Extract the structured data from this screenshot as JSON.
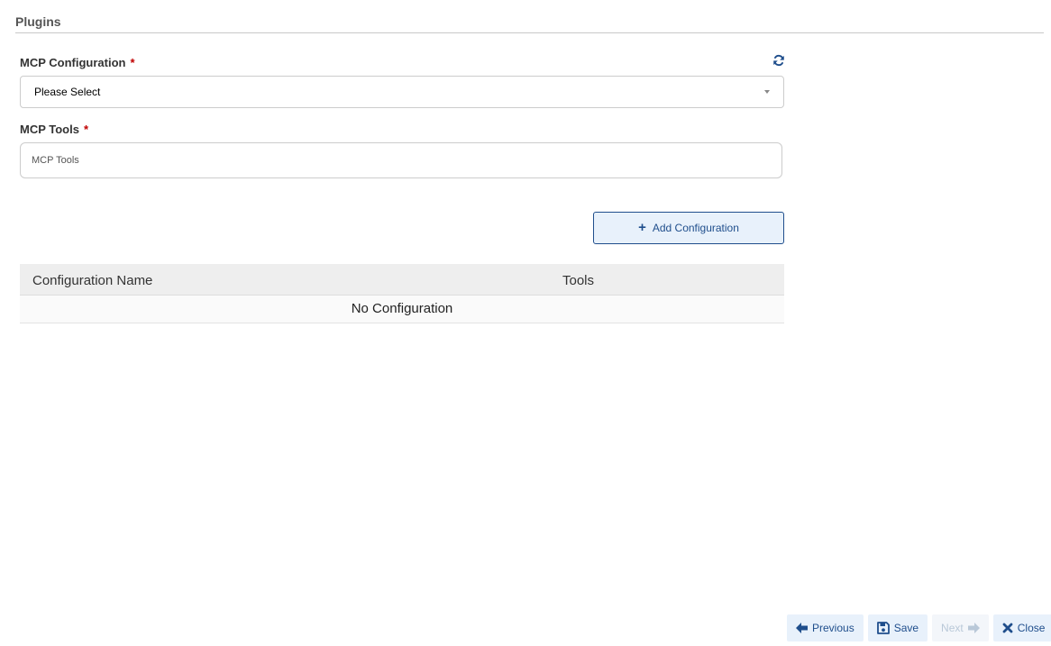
{
  "section": {
    "title": "Plugins"
  },
  "form": {
    "mcp_configuration": {
      "label": "MCP Configuration",
      "required_mark": "*",
      "selected_value": "Please Select"
    },
    "mcp_tools": {
      "label": "MCP Tools",
      "required_mark": "*",
      "placeholder": "MCP Tools"
    },
    "add_button_label": "Add Configuration"
  },
  "table": {
    "columns": [
      "Configuration Name",
      "Tools"
    ],
    "empty_text": "No Configuration"
  },
  "footer": {
    "previous_label": "Previous",
    "save_label": "Save",
    "next_label": "Next",
    "close_label": "Close"
  },
  "icons": {
    "refresh": "refresh-icon",
    "caret": "chevron-down-icon",
    "add": "plus-icon",
    "previous": "arrow-left-icon",
    "save": "floppy-disk-icon",
    "next": "arrow-right-icon",
    "close": "close-icon"
  },
  "colors": {
    "accent": "#1f4e8c",
    "button_bg": "#e8f1fb",
    "required": "#c00000",
    "table_header_bg": "#eeeeee"
  }
}
